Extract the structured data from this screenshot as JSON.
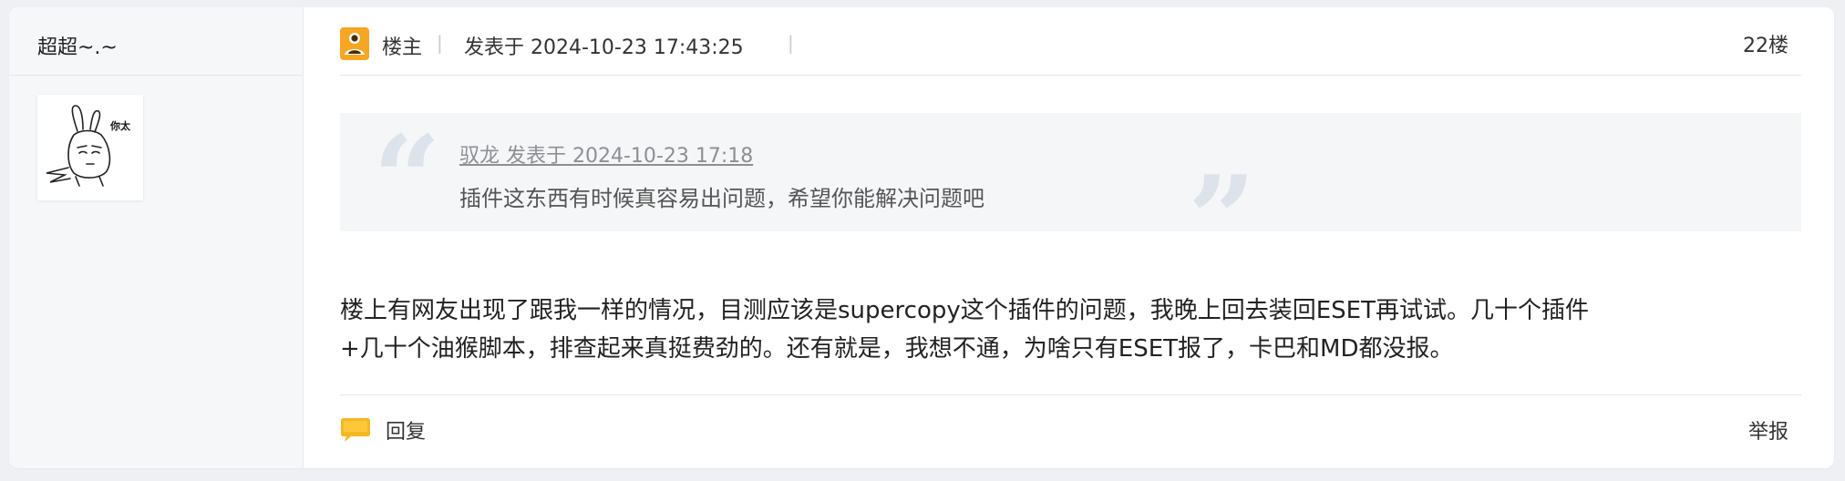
{
  "author": {
    "name": "超超~.~",
    "avatar_caption": "你太"
  },
  "meta": {
    "role": "楼主",
    "posted_at": "发表于 2024-10-23 17:43:25",
    "floor": "22楼"
  },
  "quote": {
    "source": "驭龙 发表于 2024-10-23 17:18",
    "text": "插件这东西有时候真容易出问题，希望你能解决问题吧"
  },
  "body": {
    "line1": "楼上有网友出现了跟我一样的情况，目测应该是supercopy这个插件的问题，我晚上回去装回ESET再试试。几十个插件",
    "line2": "+几十个油猴脚本，排查起来真挺费劲的。还有就是，我想不通，为啥只有ESET报了，卡巴和MD都没报。"
  },
  "footer": {
    "reply_label": "回复",
    "report_label": "举报"
  },
  "icons": {
    "op": "user-badge-icon",
    "reply": "chat-bubble-icon"
  },
  "colors": {
    "accent": "#f5a623",
    "quote_bg": "#f5f6f8",
    "sidebar_bg": "#f6f7f9"
  }
}
